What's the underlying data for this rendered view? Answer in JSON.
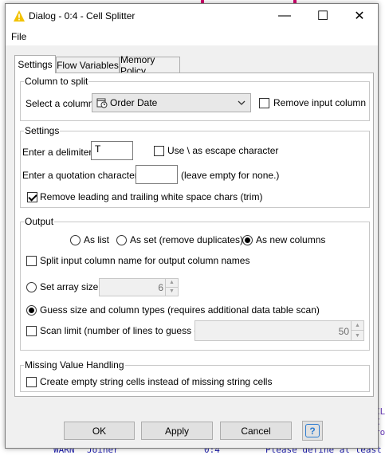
{
  "window": {
    "title": "Dialog - 0:4 - Cell Splitter",
    "minimize_glyph": "—",
    "maximize_glyph": "☐",
    "close_glyph": "✕",
    "icon": "warning-triangle-icon",
    "accent_color": "#f2c200"
  },
  "menu": {
    "file": "File"
  },
  "tabs": [
    {
      "label": "Settings",
      "active": true
    },
    {
      "label": "Flow Variables",
      "active": false
    },
    {
      "label": "Memory Policy",
      "active": false
    }
  ],
  "column_to_split": {
    "group_title": "Column to split",
    "select_label": "Select a column:",
    "selected_column": "Order Date",
    "column_icon": "calendar-clock-icon",
    "remove_input_label": "Remove input column",
    "remove_input_checked": false
  },
  "settings": {
    "group_title": "Settings",
    "delimiter_label": "Enter a delimiter:",
    "delimiter_value": "T",
    "escape_label": "Use \\ as escape character",
    "escape_checked": false,
    "quote_label": "Enter a quotation character:",
    "quote_value": "",
    "quote_hint": "(leave empty for none.)",
    "trim_label": "Remove leading and trailing white space chars (trim)",
    "trim_checked": true
  },
  "output": {
    "group_title": "Output",
    "radio_as_list": "As list",
    "radio_as_set": "As set (remove duplicates)",
    "radio_as_columns": "As new columns",
    "selected_mode": "As new columns",
    "split_name_label": "Split input column name for output column names",
    "split_name_checked": false,
    "set_array_label": "Set array size",
    "array_size": "6",
    "guess_label": "Guess size and column types (requires additional data table scan)",
    "guess_selected": true,
    "scan_limit_label": "Scan limit (number of lines to guess on)",
    "scan_limit_checked": false,
    "scan_limit_value": "50"
  },
  "missing": {
    "group_title": "Missing Value Handling",
    "empty_label": "Create empty string cells instead of missing string cells",
    "empty_checked": false
  },
  "buttons": {
    "ok": "OK",
    "apply": "Apply",
    "cancel": "Cancel",
    "help": "?"
  },
  "background_console": {
    "level": "WARN",
    "node": "Joiner",
    "id": "0:4",
    "message": "Please define at least"
  }
}
